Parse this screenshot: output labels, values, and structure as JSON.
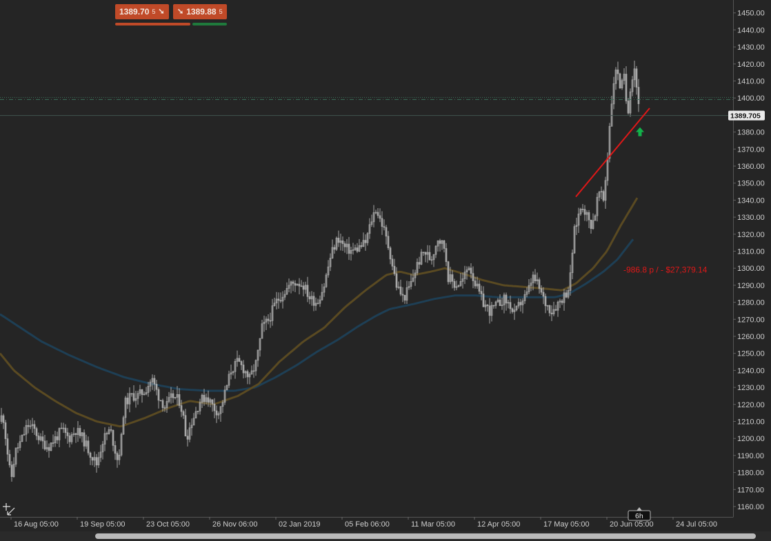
{
  "toolbar": {
    "sell_price": "1389.70",
    "sell_suffix": "5",
    "buy_price": "1389.88",
    "buy_suffix": "5",
    "sell_color": "#c04a28",
    "buy_indicator_color": "#1f7a3c"
  },
  "current_price_label": "1389.705",
  "pnl_label": "-986.8 p / - $27,379.14",
  "timeframe_label": "6h",
  "colors": {
    "background": "#252525",
    "candle": "#a8a8a8",
    "ma_fast": "#5a4a22",
    "ma_slow": "#1e3f55",
    "trendline": "#e01818",
    "buy_arrow": "#12b24a",
    "pnl_text": "#e01818"
  },
  "chart_data": {
    "type": "candlestick",
    "symbol_price_axis": {
      "ylim": [
        1155,
        1455
      ],
      "ticks": [
        1160,
        1170,
        1180,
        1190,
        1200,
        1210,
        1220,
        1230,
        1240,
        1250,
        1260,
        1270,
        1280,
        1290,
        1300,
        1310,
        1320,
        1330,
        1340,
        1350,
        1360,
        1370,
        1380,
        1390,
        1400,
        1410,
        1420,
        1430,
        1440,
        1450
      ],
      "tick_labels": [
        "1160.00",
        "1170.00",
        "1180.00",
        "1190.00",
        "1200.00",
        "1210.00",
        "1220.00",
        "1230.00",
        "1240.00",
        "1250.00",
        "1260.00",
        "1270.00",
        "1280.00",
        "1290.00",
        "1300.00",
        "1310.00",
        "1320.00",
        "1330.00",
        "1340.00",
        "1350.00",
        "1360.00",
        "1370.00",
        "1380.00",
        "1390.00",
        "1400.00",
        "1410.00",
        "1420.00",
        "1430.00",
        "1440.00",
        "1450.00"
      ]
    },
    "x_axis": {
      "tick_labels": [
        "16 Aug 05:00",
        "19 Sep 05:00",
        "23 Oct 05:00",
        "26 Nov 06:00",
        "02 Jan 2019",
        "05 Feb 06:00",
        "11 Mar 05:00",
        "12 Apr 05:00",
        "17 May 05:00",
        "20 Jun 05:00",
        "24 Jul 05:00"
      ]
    },
    "close_anchors": [
      [
        0,
        1210
      ],
      [
        4,
        1215
      ],
      [
        10,
        1195
      ],
      [
        16,
        1175
      ],
      [
        22,
        1192
      ],
      [
        30,
        1198
      ],
      [
        40,
        1208
      ],
      [
        50,
        1205
      ],
      [
        60,
        1198
      ],
      [
        70,
        1195
      ],
      [
        80,
        1200
      ],
      [
        90,
        1205
      ],
      [
        100,
        1200
      ],
      [
        110,
        1205
      ],
      [
        120,
        1200
      ],
      [
        130,
        1192
      ],
      [
        140,
        1185
      ],
      [
        150,
        1200
      ],
      [
        160,
        1205
      ],
      [
        170,
        1188
      ],
      [
        175,
        1195
      ],
      [
        180,
        1220
      ],
      [
        190,
        1225
      ],
      [
        200,
        1225
      ],
      [
        210,
        1228
      ],
      [
        220,
        1235
      ],
      [
        230,
        1225
      ],
      [
        240,
        1218
      ],
      [
        250,
        1225
      ],
      [
        260,
        1222
      ],
      [
        265,
        1215
      ],
      [
        270,
        1200
      ],
      [
        278,
        1210
      ],
      [
        290,
        1222
      ],
      [
        300,
        1225
      ],
      [
        310,
        1218
      ],
      [
        318,
        1215
      ],
      [
        325,
        1225
      ],
      [
        335,
        1240
      ],
      [
        345,
        1245
      ],
      [
        355,
        1240
      ],
      [
        362,
        1235
      ],
      [
        372,
        1245
      ],
      [
        380,
        1265
      ],
      [
        390,
        1270
      ],
      [
        400,
        1280
      ],
      [
        410,
        1285
      ],
      [
        420,
        1290
      ],
      [
        430,
        1292
      ],
      [
        440,
        1290
      ],
      [
        450,
        1282
      ],
      [
        460,
        1280
      ],
      [
        470,
        1290
      ],
      [
        480,
        1308
      ],
      [
        490,
        1318
      ],
      [
        500,
        1312
      ],
      [
        510,
        1310
      ],
      [
        520,
        1312
      ],
      [
        530,
        1315
      ],
      [
        540,
        1330
      ],
      [
        545,
        1335
      ],
      [
        555,
        1325
      ],
      [
        565,
        1310
      ],
      [
        575,
        1290
      ],
      [
        585,
        1282
      ],
      [
        595,
        1290
      ],
      [
        605,
        1302
      ],
      [
        615,
        1310
      ],
      [
        625,
        1305
      ],
      [
        635,
        1318
      ],
      [
        645,
        1312
      ],
      [
        650,
        1295
      ],
      [
        660,
        1290
      ],
      [
        670,
        1292
      ],
      [
        680,
        1302
      ],
      [
        690,
        1290
      ],
      [
        700,
        1280
      ],
      [
        710,
        1275
      ],
      [
        720,
        1278
      ],
      [
        730,
        1282
      ],
      [
        740,
        1278
      ],
      [
        745,
        1272
      ],
      [
        755,
        1280
      ],
      [
        765,
        1285
      ],
      [
        772,
        1295
      ],
      [
        780,
        1290
      ],
      [
        790,
        1280
      ],
      [
        800,
        1275
      ],
      [
        810,
        1280
      ],
      [
        820,
        1285
      ],
      [
        826,
        1290
      ],
      [
        832,
        1320
      ],
      [
        838,
        1330
      ],
      [
        844,
        1338
      ],
      [
        850,
        1332
      ],
      [
        856,
        1325
      ],
      [
        862,
        1330
      ],
      [
        868,
        1345
      ],
      [
        875,
        1340
      ],
      [
        880,
        1360
      ],
      [
        885,
        1390
      ],
      [
        890,
        1410
      ],
      [
        895,
        1418
      ],
      [
        900,
        1405
      ],
      [
        905,
        1412
      ],
      [
        910,
        1390
      ],
      [
        915,
        1410
      ],
      [
        920,
        1418
      ],
      [
        925,
        1400
      ],
      [
        928,
        1390
      ]
    ],
    "ma_fast_anchors": [
      [
        0,
        1250
      ],
      [
        20,
        1240
      ],
      [
        50,
        1230
      ],
      [
        80,
        1222
      ],
      [
        110,
        1215
      ],
      [
        140,
        1210
      ],
      [
        175,
        1207
      ],
      [
        210,
        1212
      ],
      [
        245,
        1218
      ],
      [
        275,
        1222
      ],
      [
        310,
        1220
      ],
      [
        345,
        1225
      ],
      [
        375,
        1232
      ],
      [
        405,
        1245
      ],
      [
        440,
        1257
      ],
      [
        470,
        1265
      ],
      [
        500,
        1277
      ],
      [
        530,
        1287
      ],
      [
        560,
        1296
      ],
      [
        580,
        1298
      ],
      [
        600,
        1296
      ],
      [
        625,
        1298
      ],
      [
        645,
        1300
      ],
      [
        670,
        1297
      ],
      [
        700,
        1293
      ],
      [
        730,
        1290
      ],
      [
        760,
        1289
      ],
      [
        790,
        1288
      ],
      [
        815,
        1287
      ],
      [
        835,
        1291
      ],
      [
        860,
        1300
      ],
      [
        880,
        1310
      ],
      [
        900,
        1325
      ],
      [
        925,
        1342
      ]
    ],
    "ma_slow_anchors": [
      [
        0,
        1273
      ],
      [
        30,
        1265
      ],
      [
        60,
        1257
      ],
      [
        100,
        1249
      ],
      [
        140,
        1242
      ],
      [
        180,
        1236
      ],
      [
        220,
        1232
      ],
      [
        260,
        1229
      ],
      [
        300,
        1228
      ],
      [
        340,
        1228
      ],
      [
        370,
        1230
      ],
      [
        400,
        1236
      ],
      [
        430,
        1243
      ],
      [
        460,
        1251
      ],
      [
        490,
        1258
      ],
      [
        520,
        1266
      ],
      [
        545,
        1272
      ],
      [
        565,
        1276
      ],
      [
        600,
        1279
      ],
      [
        630,
        1282
      ],
      [
        660,
        1284
      ],
      [
        690,
        1284
      ],
      [
        720,
        1283
      ],
      [
        750,
        1283
      ],
      [
        780,
        1283
      ],
      [
        805,
        1283
      ],
      [
        825,
        1285
      ],
      [
        850,
        1291
      ],
      [
        875,
        1298
      ],
      [
        895,
        1305
      ],
      [
        918,
        1317
      ]
    ],
    "current_price": 1389.705,
    "horizontal_levels": [
      1399.5
    ],
    "trendline": {
      "from": [
        835,
        1342
      ],
      "to": [
        942,
        1394
      ]
    },
    "buy_marker": {
      "x": 928,
      "price": 1380
    }
  }
}
